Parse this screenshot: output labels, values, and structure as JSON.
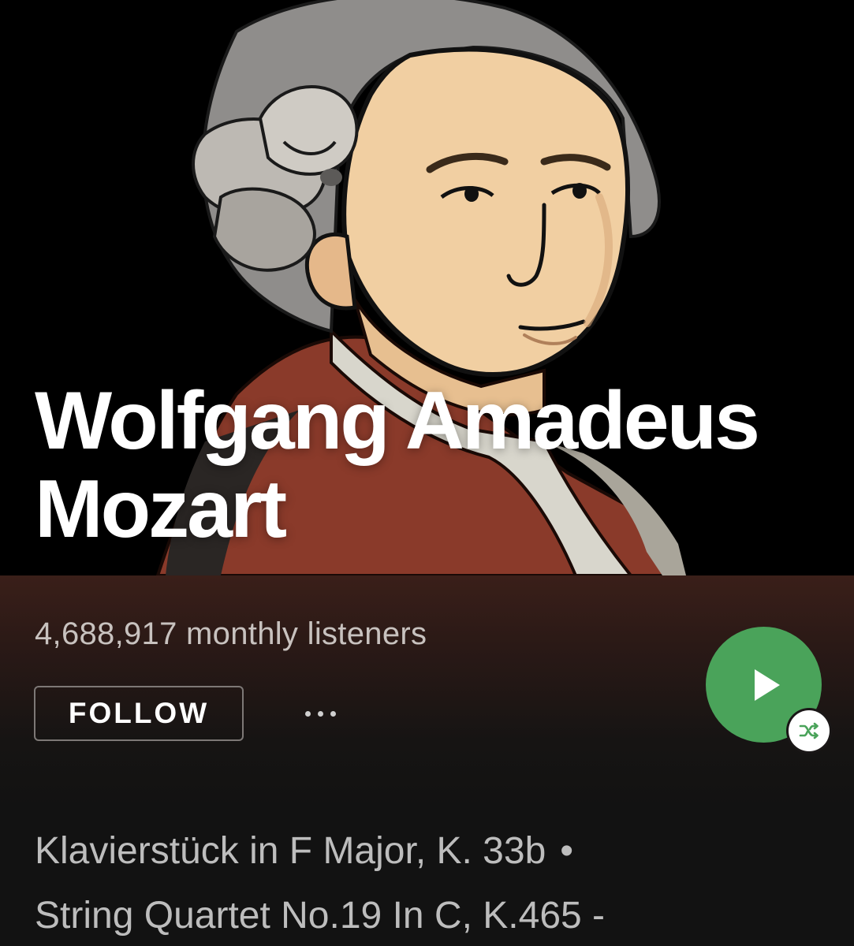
{
  "artist": {
    "name_line_1": "Wolfgang Amadeus",
    "name_line_2": "Mozart",
    "monthly_listeners": "4,688,917 monthly listeners"
  },
  "actions": {
    "follow_label": "FOLLOW",
    "more_icon": "more-options-icon",
    "play_icon": "play-icon",
    "shuffle_icon": "shuffle-icon"
  },
  "tracks": [
    {
      "title": "Klavierstück in F Major, K. 33b",
      "separator": "•"
    },
    {
      "title": "String Quartet No.19 In C, K.465 -"
    }
  ],
  "colors": {
    "play_button": "#4aa35a",
    "background": "#121212",
    "header_tint": "#3a1f19"
  }
}
